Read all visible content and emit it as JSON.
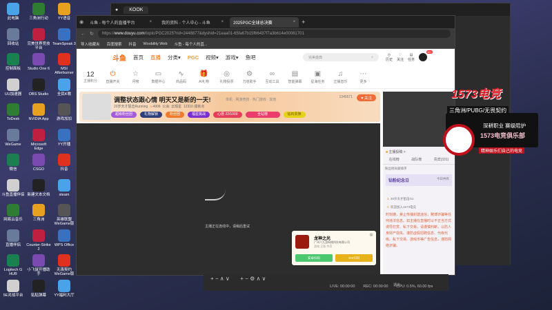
{
  "desktop_icons": [
    "此电脑",
    "三角洲行动",
    "YY语音",
    "KOOK",
    "回收站",
    "完美世界竞技平台",
    "TeamSpeak 3",
    "控制面板",
    "Studio One 6",
    "MSI Afterburner",
    "UU加速器",
    "OBS Studio",
    "全民K歌",
    "ToDesk",
    "NVIDIA App",
    "游戏加加",
    "WeGame",
    "Microsoft Edge",
    "YY开播",
    "微信",
    "CSGO",
    "抖音",
    "斗鱼直播伴侣",
    "新建文本文档",
    "steam",
    "网易云音乐",
    "三角洲",
    "英雄联盟WeGame版",
    "直播伴侣",
    "Counter-Strike 2",
    "WPS Office",
    "Logitech G HUB",
    "小飞鼠开播助手",
    "无畏契约WeGame版",
    "5E对战平台",
    "贴贴弹幕",
    "YY福利大厅"
  ],
  "back_window": {
    "tab": "KOOK"
  },
  "browser": {
    "tabs": [
      {
        "label": "斗鱼 - 每个人的直播平台"
      },
      {
        "label": "我的资料 - 个人中心 - 斗鱼"
      },
      {
        "label": "2025PGC全球总决赛"
      }
    ],
    "url_prefix": "https://",
    "url_host": "www.douyu.com",
    "url_path": "/topic/PGC2025?rid=2448877&dyshid=21eaa01-65fa67b15f66437f7a3b614e00081701",
    "bookmarks": [
      "导入收藏夹",
      "百度搜索",
      "抖音",
      "Woobility Web",
      "斗鱼 - 每个人的直..."
    ]
  },
  "site": {
    "logo": "斗鱼",
    "nav": [
      "首页",
      "直播",
      "分类▾",
      "PGC",
      "视频▾",
      "游戏▾",
      "鱼吧"
    ],
    "search_placeholder": "完美盛典",
    "header_icons": [
      "历史",
      "关注",
      "任务"
    ],
    "avatar_badge": "99+",
    "score": "12",
    "score_label": "主播积分",
    "tools": [
      "直播开关",
      "月榜",
      "数据中心",
      "商品码",
      "AI礼物",
      "礼物投票",
      "刀塔助手",
      "互动工具",
      "智能弹幕",
      "星海任务",
      "正版音乐",
      "更多"
    ]
  },
  "streamer": {
    "title": "调整状态跟心情 明天又是新的一天!",
    "category": "单机 · 网游竞技 · 热门游戏 · 其他",
    "name": "20岁天才狙击Running",
    "heat": "4906",
    "notice": "公会: 云观星",
    "fans_num": "12310 成就点",
    "follow": "关注",
    "followers": "1345571",
    "badges": [
      "超级粉丝团",
      "礼物解锁",
      "粉丝团",
      "福星挑战",
      "心愿 22/1000",
      "全站榜",
      "钻石贵族"
    ]
  },
  "video": {
    "message": "主播正在连线中，请稍后重试"
  },
  "ad": {
    "title": "龙神之光",
    "company": "广州八九游网络科技有限公司",
    "tags": "游戏 正版 传奇",
    "android": "安卓扫码",
    "ios": "iOS扫码"
  },
  "right_panel": {
    "tabs": [
      "在线榜",
      "战队榜",
      "贵宾(331)"
    ],
    "header": "主播投稿 >",
    "rank_title": "粉丝榜贡献排序",
    "event": "钻粉纪念日",
    "event_right": "今日共有",
    "rank": [
      {
        "n": "1",
        "name": "20岁天才狙击Go"
      },
      {
        "n": "2",
        "name": "欢迎加入1573电竞"
      }
    ],
    "notice": "时刻遵，禁止传播封建迷信，赌博诈骗等任何违法信息。如主播在直播时以不正当方式诱导打赏、私下交易，请谨慎判断，以防人身财产损失。谨防虚假招聘信息、代练代练、私下交易、游戏币等广告信息，谨防网络诈骗。"
  },
  "obs": {
    "live": "LIVE: 00:00:00",
    "rec": "REC: 00:00:00",
    "cpu": "CPU: 0.5%, 60.00 fps",
    "exit": "退出"
  },
  "overlay": {
    "brand": "1573电竞",
    "line1": "三角洲/PUBG/无畏契约",
    "line2": "深耕职业 赛级陪护",
    "club": "1573电竞俱乐部",
    "slogan": "精神娱乐们自己的电竞"
  }
}
